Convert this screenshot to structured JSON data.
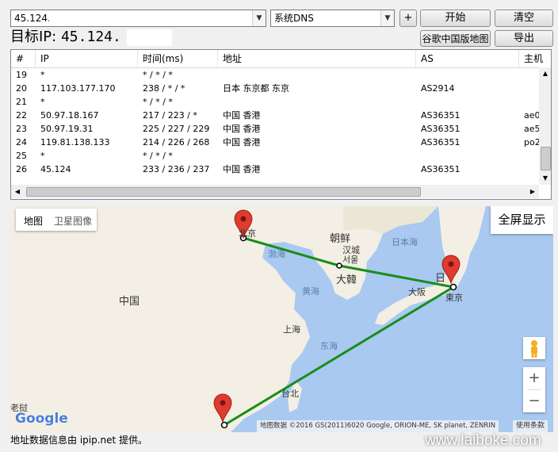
{
  "toolbar": {
    "host_value": "45.124.",
    "dns_value": "系统DNS",
    "plus_label": "+",
    "start_label": "开始",
    "clear_label": "清空",
    "google_map_label": "谷歌中国版地图",
    "export_label": "导出"
  },
  "target": {
    "label": "目标IP:",
    "ip": "45.124."
  },
  "table": {
    "columns": [
      "#",
      "IP",
      "时间(ms)",
      "地址",
      "AS",
      "主机"
    ],
    "rows": [
      {
        "num": "19",
        "ip": "*",
        "time": "* / * / *",
        "addr": "",
        "as": "",
        "host": ""
      },
      {
        "num": "20",
        "ip": "117.103.177.170",
        "time": "238 / * / *",
        "addr": "日本 东京都 东京",
        "as": "AS2914",
        "host": ""
      },
      {
        "num": "21",
        "ip": "*",
        "time": "* / * / *",
        "addr": "",
        "as": "",
        "host": ""
      },
      {
        "num": "22",
        "ip": "50.97.18.167",
        "time": "217 / 223 / *",
        "addr": "中国 香港",
        "as": "AS36351",
        "host": "ae0"
      },
      {
        "num": "23",
        "ip": "50.97.19.31",
        "time": "225 / 227 / 229",
        "addr": "中国 香港",
        "as": "AS36351",
        "host": "ae5"
      },
      {
        "num": "24",
        "ip": "119.81.138.133",
        "time": "214 / 226 / 268",
        "addr": "中国 香港",
        "as": "AS36351",
        "host": "po2"
      },
      {
        "num": "25",
        "ip": "*",
        "time": "* / * / *",
        "addr": "",
        "as": "",
        "host": ""
      },
      {
        "num": "26",
        "ip": "45.124",
        "time": "233 / 236 / 237",
        "addr": "中国 香港",
        "as": "AS36351",
        "host": ""
      }
    ]
  },
  "map": {
    "tab_map": "地图",
    "tab_satellite": "卫星图像",
    "fullscreen": "全屏显示",
    "labels": {
      "beijing": "北京",
      "bohai": "渤海",
      "korea": "朝鲜",
      "hanseong": "汉城",
      "seoul": "서울",
      "south_korea": "大韓",
      "sea_of_japan": "日本海",
      "japan": "日",
      "tokyo": "東京",
      "osaka": "大阪",
      "china": "中国",
      "yellow_sea": "黄海",
      "shanghai": "上海",
      "east_sea": "东海",
      "taipei": "台北",
      "laos": "老挝"
    },
    "google_logo": "Google",
    "attribution": "地图数据 ©2016 GS(2011)6020 Google, ORION-ME, SK planet, ZENRIN",
    "terms": "使用条款",
    "zoom_in": "+",
    "zoom_out": "−"
  },
  "footer": {
    "info": "地址数据信息由 ipip.net 提供。",
    "watermark": "www.laiboke.com"
  },
  "colors": {
    "route": "#1a8c1a",
    "pin": "#e03b2f",
    "water": "#a9c9f1",
    "land": "#f3efe4"
  }
}
